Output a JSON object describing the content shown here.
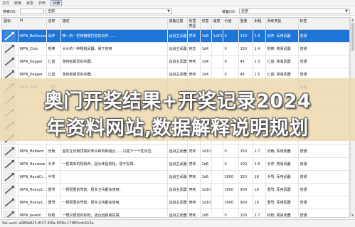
{
  "menu": [
    "文件",
    "转换",
    "状态",
    "护甲",
    "武器"
  ],
  "filter": {
    "search_label": "搜索(S):",
    "scope_value": "全部",
    "category_label": "装备(O):",
    "category_value": "全部"
  },
  "columns": [
    "图标",
    "Id",
    "名称",
    "描述",
    "装备位置",
    "伤害类型",
    "伤害",
    "速度",
    "价值",
    "重量",
    "射程",
    "熟练类型",
    "标签"
  ],
  "rows": [
    {
      "id": "WPN_Battleaxe",
      "name": "战斧",
      "desc": "唯一的一把用精钢打造的战斧……",
      "slot": "远战主武器",
      "dtype": "劈砍",
      "dmg": "1d8",
      "spd": "1d10",
      "val": "0",
      "wt": "150",
      "rng": "1.8",
      "prof": "战斧, 军用武器",
      "tag": "普通"
    },
    {
      "id": "WPN_Club",
      "name": "棍棒",
      "desc": "木头的一种粗糙武器，易于使用",
      "slot": "远战主武器",
      "dtype": "钝击",
      "dmg": "1d4",
      "spd": "",
      "val": "0",
      "wt": "150",
      "rng": "1.4",
      "prof": "棍棒, 简易武器",
      "tag": "普通"
    },
    {
      "id": "WPN_Dagger",
      "name": "匕首",
      "desc": "游侠者最爱的兵器。",
      "slot": "远战主武器",
      "dtype": "穿刺",
      "dmg": "1d4",
      "spd": "",
      "val": "0",
      "wt": "45",
      "rng": "1.5",
      "prof": "匕首, 简易武器",
      "tag": "普通"
    },
    {
      "id": "WPN_Dagger",
      "name": "匕首",
      "desc": "游侠者最爱的兵器。",
      "slot": "远战主武器",
      "dtype": "穿刺",
      "dmg": "1d4",
      "spd": "",
      "val": "0",
      "wt": "45",
      "rng": "1.5",
      "prof": "匕首, 简易武器",
      "tag": "普通"
    },
    {
      "id": "WPN_Dart",
      "name": "飞镖",
      "desc": "",
      "slot": "",
      "dtype": "",
      "dmg": "",
      "spd": "",
      "val": "",
      "wt": "",
      "rng": "",
      "prof": "",
      "tag": "普通"
    },
    {
      "id": "",
      "name": "",
      "desc": "",
      "slot": "",
      "dtype": "",
      "dmg": "",
      "spd": "",
      "val": "",
      "wt": "",
      "rng": "",
      "prof": "",
      "tag": ""
    },
    {
      "id": "",
      "name": "",
      "desc": "",
      "slot": "",
      "dtype": "",
      "dmg": "",
      "spd": "",
      "val": "",
      "wt": "",
      "rng": "",
      "prof": "",
      "tag": ""
    },
    {
      "id": "",
      "name": "",
      "desc": "",
      "slot": "",
      "dtype": "",
      "dmg": "",
      "spd": "",
      "val": "",
      "wt": "",
      "rng": "",
      "prof": "",
      "tag": ""
    },
    {
      "id": "",
      "name": "",
      "desc": "",
      "slot": "",
      "dtype": "",
      "dmg": "",
      "spd": "",
      "val": "",
      "wt": "",
      "rng": "",
      "prof": "",
      "tag": "普通"
    },
    {
      "id": "WPN_Halberd",
      "name": "长戟",
      "desc": "固定在长柄顶端的斧头和钩刺组合……只能下一个性攻击。",
      "slot": "远战主武器",
      "dtype": "劈砍",
      "dmg": "1d10",
      "spd": "",
      "val": "0",
      "wt": "250",
      "rng": "2.7",
      "prof": "长戟, 军用武器",
      "tag": "普通"
    },
    {
      "id": "WPN_Handaxe",
      "name": "手斧",
      "desc": "一把简单的短柄斧，因为体型较轻，便于投掷。",
      "slot": "远战主武器",
      "dtype": "劈砍",
      "dmg": "1d6",
      "spd": "",
      "val": "0",
      "wt": "100",
      "rng": "1.6",
      "prof": "手斧, 简易武器",
      "tag": "普通"
    },
    {
      "id": "WPN_HandCr...",
      "name": "手弩",
      "desc": "",
      "slot": "远战主武器",
      "dtype": "穿刺",
      "dmg": "1d6",
      "spd": "",
      "val": "3000",
      "wt": "150",
      "rng": "18",
      "prof": "手弩, 军用武器",
      "tag": "普通"
    },
    {
      "id": "WPN_HeavyC...",
      "name": "重弩",
      "desc": "一把很重的弩箭，很多卫兵都会使用。",
      "slot": "远战主武器",
      "dtype": "穿刺",
      "dmg": "1d10",
      "spd": "",
      "val": "3000",
      "wt": "900",
      "rng": "18",
      "prof": "重弩, 军用武器",
      "tag": "普通"
    },
    {
      "id": "WPN_HeavyC...",
      "name": "重弩",
      "desc": "一把很重的弩箭，很多卫兵都会使用。",
      "slot": "远战主武器",
      "dtype": "穿刺",
      "dmg": "1d10",
      "spd": "",
      "val": "3000",
      "wt": "900",
      "rng": "18",
      "prof": "重弩, 军用武器",
      "tag": "普通"
    },
    {
      "id": "WPN_Javelin",
      "name": "标枪",
      "desc": "一根仅很轻的标枪，适合远距离投掷。",
      "slot": "远战主武器",
      "dtype": "穿刺",
      "dmg": "1d6",
      "spd": "",
      "val": "0",
      "wt": "100",
      "rng": "1.7",
      "prof": "标枪, 简易武器",
      "tag": "普通"
    }
  ],
  "status": "Sel uuid: a086b825-8f17-4f0e-855b-17f8f0cdc515a",
  "overlay": {
    "line1": "奥门开奖结果+开奖记录2024",
    "line2": "年资料网站,数据解释说明规划"
  },
  "colors": {
    "selection": "#1e75d8",
    "overlay": "#ebd7aa"
  }
}
